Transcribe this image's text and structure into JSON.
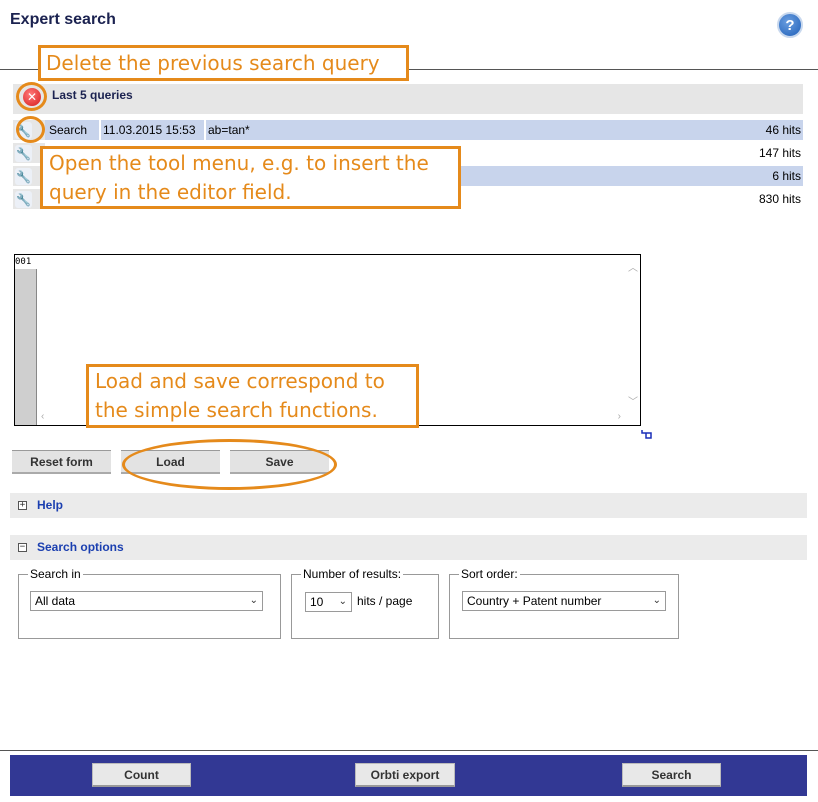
{
  "page": {
    "title": "Expert search",
    "help_icon": "question-mark-icon"
  },
  "queries": {
    "header_label": "Last 5 queries",
    "delete_icon": "close-icon",
    "rows": [
      {
        "type": "Search",
        "date": "11.03.2015 15:53",
        "query": "ab=tan*",
        "hits": "46 hits"
      },
      {
        "type": "",
        "date": "",
        "query": "",
        "hits": "147 hits"
      },
      {
        "type": "",
        "date": "",
        "query": "",
        "hits": "6 hits"
      },
      {
        "type": "",
        "date": "",
        "query": "",
        "hits": "830 hits"
      }
    ]
  },
  "editor": {
    "first_line_number": "001",
    "content": ""
  },
  "buttons": {
    "reset": "Reset form",
    "load": "Load",
    "save": "Save"
  },
  "sections": {
    "help": "Help",
    "search_options": "Search options"
  },
  "options": {
    "search_in_label": "Search in",
    "search_in_value": "All data",
    "results_label": "Number of results:",
    "results_value": "10",
    "results_unit": "hits / page",
    "sort_label": "Sort order:",
    "sort_value": "Country + Patent number"
  },
  "footer": {
    "count": "Count",
    "export": "Orbti export",
    "search": "Search"
  },
  "annotations": {
    "delete": "Delete the previous search query",
    "tools": "Open the tool menu, e.g. to insert the query in the editor field.",
    "tools_line1": "Open the tool menu, e.g. to insert the",
    "tools_line2": "query in the editor field.",
    "loadsave_line1": "Load and save correspond to",
    "loadsave_line2": "the simple search functions."
  },
  "colors": {
    "accent": "#e58a1b",
    "footer": "#323894",
    "selected_row": "#c8d4ec",
    "link": "#1b3fb0"
  }
}
